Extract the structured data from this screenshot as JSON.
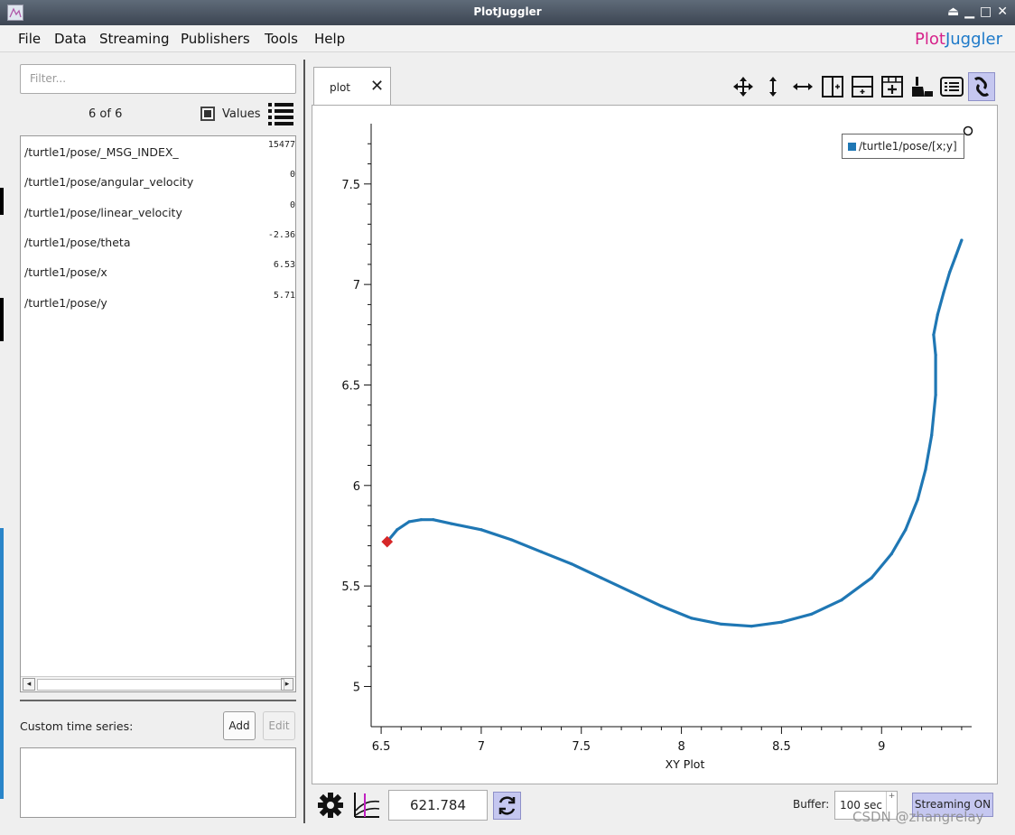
{
  "window": {
    "title": "PlotJuggler"
  },
  "menu": [
    "File",
    "Data",
    "Streaming",
    "Publishers",
    "Tools",
    "Help"
  ],
  "logo": {
    "part1": "Plot",
    "part2": "Juggler"
  },
  "left_panel": {
    "filter_placeholder": "Filter...",
    "count": "6 of 6",
    "values_label": "Values",
    "values_checked": true,
    "series": [
      {
        "name": "/turtle1/pose/_MSG_INDEX_",
        "value": "15477"
      },
      {
        "name": "/turtle1/pose/angular_velocity",
        "value": "0"
      },
      {
        "name": "/turtle1/pose/linear_velocity",
        "value": "0"
      },
      {
        "name": "/turtle1/pose/theta",
        "value": "-2.36"
      },
      {
        "name": "/turtle1/pose/x",
        "value": "6.53"
      },
      {
        "name": "/turtle1/pose/y",
        "value": "5.71"
      }
    ],
    "custom_label": "Custom time series:",
    "add_label": "Add",
    "edit_label": "Edit"
  },
  "tab": {
    "label": "plot",
    "close": "✕"
  },
  "toolbar_icons": [
    "move-arrows-icon",
    "vertical-zoom-icon",
    "horizontal-zoom-icon",
    "split-vertical-icon",
    "split-horizontal-icon",
    "add-grid-icon",
    "clear-broom-icon",
    "legend-icon",
    "link-icon"
  ],
  "chart_data": {
    "type": "scatter",
    "title": "",
    "xlabel": "XY Plot",
    "ylabel": "",
    "xlim": [
      6.45,
      9.45
    ],
    "ylim": [
      4.8,
      7.8
    ],
    "xticks": [
      "6.5",
      "7",
      "7.5",
      "8",
      "8.5",
      "9"
    ],
    "xtick_values": [
      6.5,
      7,
      7.5,
      8,
      8.5,
      9
    ],
    "yticks": [
      "5",
      "5.5",
      "6",
      "6.5",
      "7",
      "7.5"
    ],
    "ytick_values": [
      5,
      5.5,
      6,
      6.5,
      7,
      7.5
    ],
    "series": [
      {
        "name": "/turtle1/pose/[x;y]",
        "color": "#1f77b4",
        "x": [
          6.53,
          6.58,
          6.64,
          6.7,
          6.76,
          6.85,
          7.0,
          7.15,
          7.3,
          7.45,
          7.6,
          7.75,
          7.9,
          8.05,
          8.2,
          8.35,
          8.5,
          8.65,
          8.8,
          8.95,
          9.05,
          9.12,
          9.18,
          9.22,
          9.25,
          9.27,
          9.27,
          9.26,
          9.28,
          9.31,
          9.34,
          9.37,
          9.4
        ],
        "y": [
          5.72,
          5.78,
          5.82,
          5.83,
          5.83,
          5.81,
          5.78,
          5.73,
          5.67,
          5.61,
          5.54,
          5.47,
          5.4,
          5.34,
          5.31,
          5.3,
          5.32,
          5.36,
          5.43,
          5.54,
          5.66,
          5.78,
          5.93,
          6.08,
          6.25,
          6.45,
          6.65,
          6.75,
          6.85,
          6.96,
          7.06,
          7.14,
          7.22
        ]
      }
    ],
    "current_marker": {
      "x": 6.53,
      "y": 5.72,
      "color": "#d62728"
    },
    "legend": "top-right",
    "grid": false
  },
  "bottom": {
    "time_value": "621.784",
    "buffer_label": "Buffer:",
    "buffer_value": "100 sec",
    "streaming_label": "Streaming ON",
    "watermark": "CSDN @zhangrelay"
  }
}
